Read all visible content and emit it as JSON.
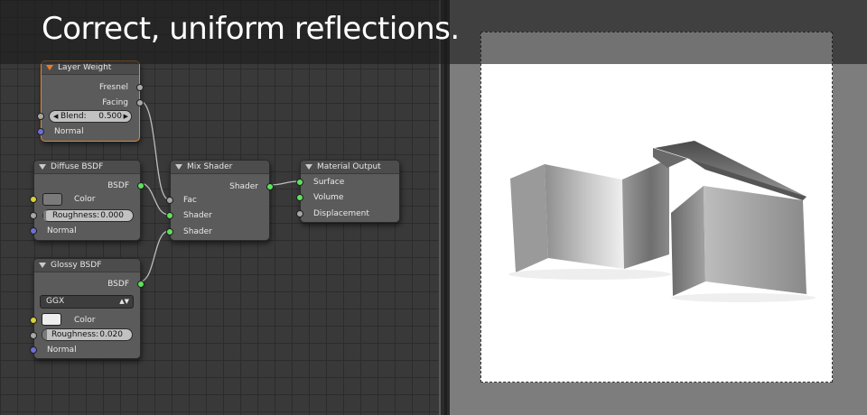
{
  "banner": {
    "title": "Correct, uniform reflections."
  },
  "nodes": {
    "layer_weight": {
      "title": "Layer Weight",
      "outputs": [
        "Fresnel",
        "Facing"
      ],
      "blend_label": "Blend:",
      "blend_value": "0.500",
      "blend_fraction": 0.5,
      "normal_label": "Normal"
    },
    "diffuse": {
      "title": "Diffuse BSDF",
      "output": "BSDF",
      "color_label": "Color",
      "color": "#7a7a7a",
      "roughness_label": "Roughness:",
      "roughness_value": "0.000",
      "normal_label": "Normal"
    },
    "glossy": {
      "title": "Glossy BSDF",
      "output": "BSDF",
      "distribution": "GGX",
      "color_label": "Color",
      "color": "#eeeeee",
      "roughness_label": "Roughness:",
      "roughness_value": "0.020",
      "normal_label": "Normal"
    },
    "mix": {
      "title": "Mix Shader",
      "output": "Shader",
      "inputs": [
        "Fac",
        "Shader",
        "Shader"
      ]
    },
    "output": {
      "title": "Material Output",
      "inputs": [
        "Surface",
        "Volume",
        "Displacement"
      ]
    }
  },
  "colors": {
    "active_border": "#e08a2b",
    "socket_shader": "#5fe05c",
    "socket_float": "#a8a8a8",
    "socket_vector": "#6b6fd6",
    "socket_color": "#d8d23a"
  }
}
